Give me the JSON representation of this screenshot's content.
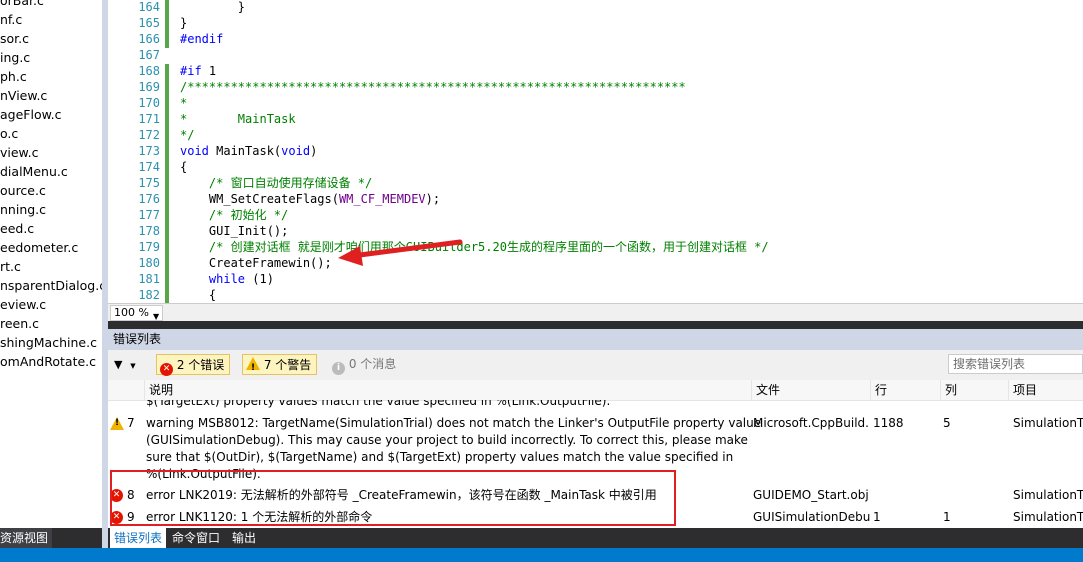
{
  "sidebar": {
    "files": [
      "orBar.c",
      "nf.c",
      "sor.c",
      "ing.c",
      "ph.c",
      "nView.c",
      "ageFlow.c",
      "o.c",
      "view.c",
      "dialMenu.c",
      "ource.c",
      "nning.c",
      "eed.c",
      "eedometer.c",
      "rt.c",
      "nsparentDialog.c",
      "eview.c",
      "reen.c",
      "shingMachine.c",
      "omAndRotate.c"
    ],
    "bottom_tab": "资源视图"
  },
  "editor": {
    "lines": [
      {
        "num": "164",
        "segments": [
          {
            "t": "        }",
            "c": ""
          }
        ]
      },
      {
        "num": "165",
        "segments": [
          {
            "t": "}",
            "c": ""
          }
        ]
      },
      {
        "num": "166",
        "segments": [
          {
            "t": "#endif",
            "c": "pp"
          }
        ]
      },
      {
        "num": "167",
        "segments": [
          {
            "t": "",
            "c": ""
          }
        ]
      },
      {
        "num": "168",
        "segments": [
          {
            "t": "#if ",
            "c": "pp"
          },
          {
            "t": "1",
            "c": ""
          }
        ]
      },
      {
        "num": "169",
        "segments": [
          {
            "t": "/*********************************************************************",
            "c": "cm"
          }
        ]
      },
      {
        "num": "170",
        "segments": [
          {
            "t": "*",
            "c": "cm"
          }
        ]
      },
      {
        "num": "171",
        "segments": [
          {
            "t": "*       MainTask",
            "c": "cm"
          }
        ]
      },
      {
        "num": "172",
        "segments": [
          {
            "t": "*/",
            "c": "cm"
          }
        ]
      },
      {
        "num": "173",
        "segments": [
          {
            "t": "void",
            "c": "kw"
          },
          {
            "t": " MainTask(",
            "c": ""
          },
          {
            "t": "void",
            "c": "kw"
          },
          {
            "t": ")",
            "c": ""
          }
        ]
      },
      {
        "num": "174",
        "segments": [
          {
            "t": "{",
            "c": ""
          }
        ]
      },
      {
        "num": "175",
        "segments": [
          {
            "t": "    /* 窗口自动使用存储设备 */",
            "c": "cm"
          }
        ]
      },
      {
        "num": "176",
        "segments": [
          {
            "t": "    WM_SetCreateFlags(",
            "c": ""
          },
          {
            "t": "WM_CF_MEMDEV",
            "c": "mac"
          },
          {
            "t": ");",
            "c": ""
          }
        ]
      },
      {
        "num": "177",
        "segments": [
          {
            "t": "    /* 初始化 */",
            "c": "cm"
          }
        ]
      },
      {
        "num": "178",
        "segments": [
          {
            "t": "    GUI_Init();",
            "c": ""
          }
        ]
      },
      {
        "num": "179",
        "segments": [
          {
            "t": "    /* 创建对话框 就是刚才咱们用那个GUIBuilder5.20生成的程序里面的一个函数，用于创建对话框 */",
            "c": "cm"
          }
        ]
      },
      {
        "num": "180",
        "segments": [
          {
            "t": "    CreateFramewin();",
            "c": ""
          }
        ]
      },
      {
        "num": "181",
        "segments": [
          {
            "t": "    ",
            "c": ""
          },
          {
            "t": "while",
            "c": "kw"
          },
          {
            "t": " (1)",
            "c": ""
          }
        ]
      },
      {
        "num": "182",
        "segments": [
          {
            "t": "    {",
            "c": ""
          }
        ]
      }
    ],
    "zoom": "100 %"
  },
  "error_list": {
    "title": "错误列表",
    "errors_btn": "2 个错误",
    "warnings_btn": "7 个警告",
    "messages_btn": "0 个消息",
    "search_placeholder": "搜索错误列表",
    "columns": {
      "desc": "说明",
      "file": "文件",
      "line": "行",
      "col": "列",
      "project": "项目"
    },
    "partial_row": "$(TargetExt) property values match the value specified in %(Link.OutputFile).",
    "rows": [
      {
        "type": "warning",
        "num": "7",
        "desc_lines": [
          "warning MSB8012: TargetName(SimulationTrial) does not match the Linker's OutputFile property value",
          "(GUISimulationDebug). This may cause your project to build incorrectly. To correct this, please make",
          "sure that $(OutDir), $(TargetName) and $(TargetExt) property values match the value specified in",
          "%(Link.OutputFile)."
        ],
        "file": "Microsoft.CppBuild.",
        "line": "1188",
        "col": "5",
        "project": "SimulationTr"
      },
      {
        "type": "error",
        "num": "8",
        "desc_lines": [
          "error LNK2019: 无法解析的外部符号 _CreateFramewin，该符号在函数 _MainTask 中被引用"
        ],
        "file": "GUIDEMO_Start.obj",
        "line": "",
        "col": "",
        "project": "SimulationTr"
      },
      {
        "type": "error",
        "num": "9",
        "desc_lines": [
          "error LNK1120: 1 个无法解析的外部命令"
        ],
        "file": "GUISimulationDebu",
        "line": "1",
        "col": "1",
        "project": "SimulationTr"
      }
    ]
  },
  "bottom_tabs": [
    "错误列表",
    "命令窗口",
    "输出"
  ],
  "colors": {
    "accent": "#007acc",
    "annotation": "#e02020",
    "error": "#e51400",
    "warning": "#f0b400"
  }
}
